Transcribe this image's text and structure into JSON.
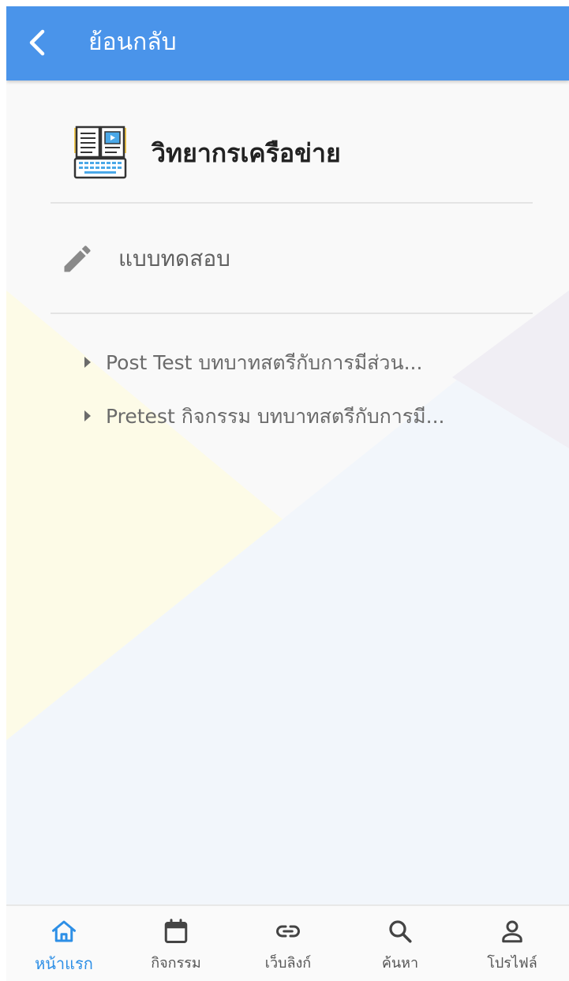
{
  "topbar": {
    "back_label": "ย้อนกลับ",
    "back_icon": "chevron-left-icon",
    "background": "#4a94ea"
  },
  "section": {
    "title": "วิทยากรเครือข่าย",
    "icon": "elearning-book-icon"
  },
  "category": {
    "label": "แบบทดสอบ",
    "icon": "pencil-icon"
  },
  "items": [
    {
      "label": "Post Test บทบาทสตรีกับการมีส่วน..."
    },
    {
      "label": "Pretest กิจกรรม บทบาทสตรีกับการมี..."
    }
  ],
  "bottom_nav": {
    "active_color": "#2d8fe6",
    "tabs": [
      {
        "label": "หน้าแรก",
        "icon": "home-icon",
        "active": true
      },
      {
        "label": "กิจกรรม",
        "icon": "calendar-icon",
        "active": false
      },
      {
        "label": "เว็บลิงก์",
        "icon": "link-icon",
        "active": false
      },
      {
        "label": "ค้นหา",
        "icon": "search-icon",
        "active": false
      },
      {
        "label": "โปรไฟล์",
        "icon": "person-icon",
        "active": false
      }
    ]
  }
}
